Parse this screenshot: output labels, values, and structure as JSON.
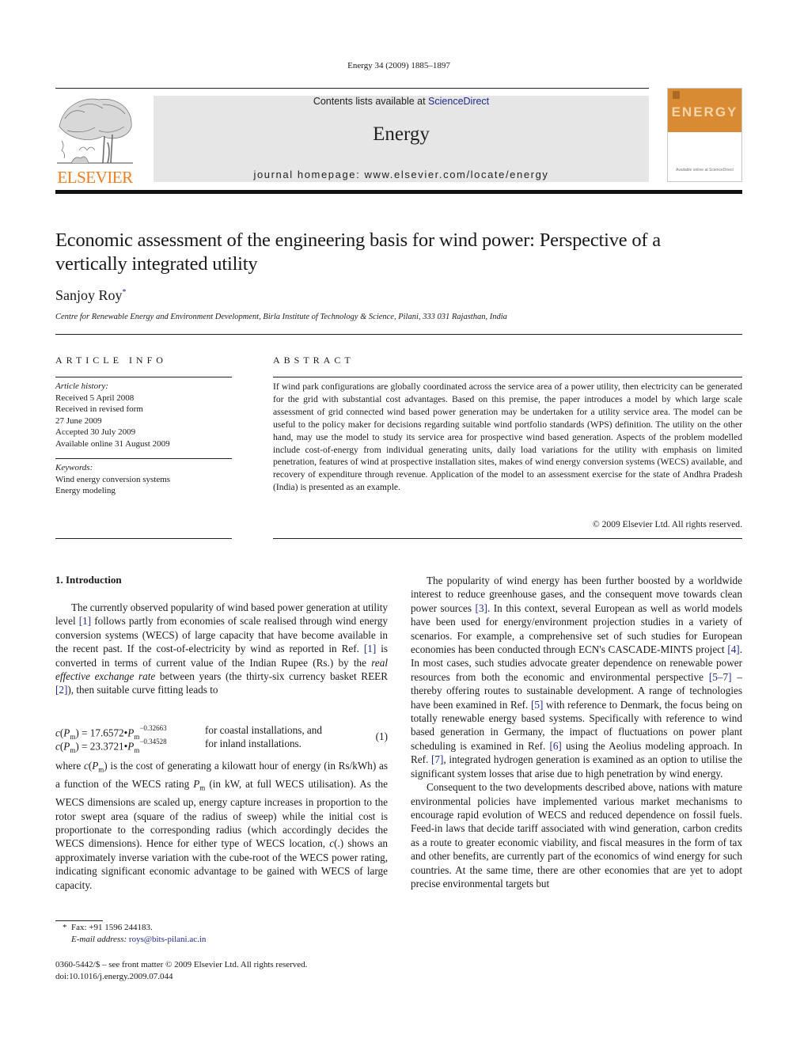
{
  "header": {
    "citation": "Energy 34 (2009) 1885–1897",
    "contents_prefix": "Contents lists available at ",
    "contents_link": "ScienceDirect",
    "journal_name": "Energy",
    "homepage": "journal homepage: www.elsevier.com/locate/energy",
    "publisher_logo_text": "ELSEVIER",
    "publisher_logo_icon": "elsevier-tree-icon",
    "cover_title": "ENERGY",
    "cover_footer": "Available online at ScienceDirect",
    "colors": {
      "elsevier_orange": "#ef7d22",
      "link_blue": "#1f2a8c",
      "band_gray": "#e6e6e6",
      "cover_orange": "#d98b34"
    }
  },
  "article": {
    "title": "Economic assessment of the engineering basis for wind power: Perspective of a vertically integrated utility",
    "author": "Sanjoy Roy",
    "author_mark": "*",
    "affiliation": "Centre for Renewable Energy and Environment Development, Birla Institute of Technology & Science, Pilani, 333 031 Rajasthan, India"
  },
  "article_info": {
    "heading": "ARTICLE INFO",
    "history_label": "Article history:",
    "history": [
      "Received 5 April 2008",
      "Received in revised form",
      "27 June 2009",
      "Accepted 30 July 2009",
      "Available online 31 August 2009"
    ],
    "keywords_label": "Keywords:",
    "keywords": [
      "Wind energy conversion systems",
      "Energy modeling"
    ]
  },
  "abstract": {
    "heading": "ABSTRACT",
    "text": "If wind park configurations are globally coordinated across the service area of a power utility, then electricity can be generated for the grid with substantial cost advantages. Based on this premise, the paper introduces a model by which large scale assessment of grid connected wind based power generation may be undertaken for a utility service area. The model can be useful to the policy maker for decisions regarding suitable wind portfolio standards (WPS) definition. The utility on the other hand, may use the model to study its service area for prospective wind based generation. Aspects of the problem modelled include cost-of-energy from individual generating units, daily load variations for the utility with emphasis on limited penetration, features of wind at prospective installation sites, makes of wind energy conversion systems (WECS) available, and recovery of expenditure through revenue. Application of the model to an assessment exercise for the state of Andhra Pradesh (India) is presented as an example.",
    "copyright": "© 2009 Elsevier Ltd. All rights reserved."
  },
  "body": {
    "section_heading": "1.  Introduction",
    "left_p1": [
      {
        "t": "The currently observed popularity of wind based power gener­ation at utility level "
      },
      {
        "ref": "[1]"
      },
      {
        "t": " follows partly from economies of scale realised through wind energy conversion systems (WECS) of large capacity that have become available in the recent past. If the cost-of-electricity by wind as reported in Ref. "
      },
      {
        "ref": "[1]"
      },
      {
        "t": " is converted in terms of current value of the Indian Rupee (Rs.) by the "
      },
      {
        "i": "real effective exchange rate"
      },
      {
        "t": " between years (the thirty-six currency basket REER "
      },
      {
        "ref": "[2]"
      },
      {
        "t": "), then suitable curve fitting leads to"
      }
    ],
    "equation": {
      "rows": [
        {
          "lhs_func": "c",
          "lhs_var": "P",
          "lhs_sub": "m",
          "coef": "17.6572",
          "exp": "−0.32663",
          "desc": "for coastal installations, and"
        },
        {
          "lhs_func": "c",
          "lhs_var": "P",
          "lhs_sub": "m",
          "coef": "23.3721",
          "exp": "−0.34528",
          "desc": "for inland installations."
        }
      ],
      "number": "(1)"
    },
    "left_p2": [
      {
        "t": "where "
      },
      {
        "i": "c"
      },
      {
        "t": "("
      },
      {
        "i": "P"
      },
      {
        "sub": "m"
      },
      {
        "t": ") is the cost of generating a kilowatt hour of energy (in Rs/kWh) as a function of the WECS rating "
      },
      {
        "i": "P"
      },
      {
        "sub": "m"
      },
      {
        "t": " (in kW, at full WECS utilisation). As the WECS dimensions are scaled up, energy capture increases in proportion to the rotor swept area (square of the radius of sweep) while the initial cost is proportionate to the corre­sponding radius (which accordingly decides the WECS dimen­sions). Hence for either type of WECS location, "
      },
      {
        "i": "c"
      },
      {
        "t": "(.) shows an approximately inverse variation with the cube-root of the WECS power rating, indicating significant economic advantage to be gained with WECS of large capacity."
      }
    ],
    "right_p1": [
      {
        "t": "The popularity of wind energy has been further boosted by a worldwide interest to reduce greenhouse gases, and the conse­quent move towards clean power sources "
      },
      {
        "ref": "[3]"
      },
      {
        "t": ". In this context, several European as well as world models have been used for energy/environment projection studies in a variety of scenarios. For example, a comprehensive set of such studies for European econ­omies has been conducted through ECN's CASCADE-MINTS project "
      },
      {
        "ref": "[4]"
      },
      {
        "t": ". In most cases, such studies advocate greater dependence on renewable power resources from both the economic and environ­mental perspective "
      },
      {
        "ref": "[5–7]"
      },
      {
        "t": " – thereby offering routes to sustainable development. A range of technologies have been examined in Ref. "
      },
      {
        "ref": "[5]"
      },
      {
        "t": " with reference to Denmark, the focus being on totally renewable energy based systems. Specifically with reference to wind based generation in Germany, the impact of fluctuations on power plant scheduling is examined in Ref. "
      },
      {
        "ref": "[6]"
      },
      {
        "t": " using the Aeolius modeling approach. In Ref. "
      },
      {
        "ref": "[7]"
      },
      {
        "t": ", integrated hydrogen generation is examined as an option to utilise the significant system losses that arise due to high penetration by wind energy."
      }
    ],
    "right_p2": [
      {
        "t": "Consequent to the two developments described above, nations with mature environmental policies have implemented various market mechanisms to encourage rapid evolution of WECS and reduced dependence on fossil fuels. Feed-in laws that decide tariff associated with wind generation, carbon credits as a route to greater economic viability, and fiscal measures in the form of tax and other benefits, are currently part of the economics of wind energy for such countries. At the same time, there are other economies that are yet to adopt precise environmental targets but"
      }
    ]
  },
  "footnote": {
    "mark": "*",
    "fax": "Fax: +91 1596 244183.",
    "email_label": "E-mail address:",
    "email": "roys@bits-pilani.ac.in"
  },
  "issn": {
    "line1": "0360-5442/$ – see front matter © 2009 Elsevier Ltd. All rights reserved.",
    "line2": "doi:10.1016/j.energy.2009.07.044"
  }
}
